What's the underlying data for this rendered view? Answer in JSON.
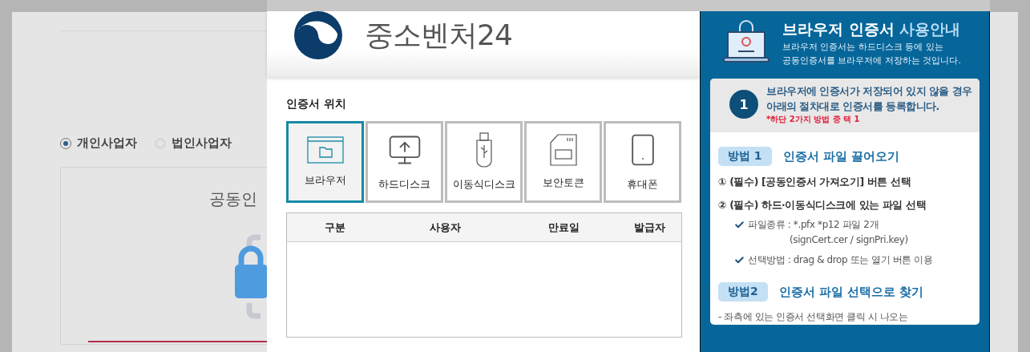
{
  "background_page": {
    "radio_options": [
      {
        "label": "개인사업자",
        "selected": true
      },
      {
        "label": "법인사업자",
        "selected": false
      }
    ],
    "card_title": "공동인"
  },
  "modal": {
    "logo_text": "중소벤처24",
    "location_label": "인증서 위치",
    "locations": [
      {
        "label": "브라우저",
        "kind": "browser",
        "selected": true
      },
      {
        "label": "하드디스크",
        "kind": "harddisk",
        "selected": false
      },
      {
        "label": "이동식디스크",
        "kind": "usb",
        "selected": false
      },
      {
        "label": "보안토큰",
        "kind": "token",
        "selected": false
      },
      {
        "label": "휴대폰",
        "kind": "phone",
        "selected": false
      }
    ],
    "table": {
      "columns": [
        "구분",
        "사용자",
        "만료일",
        "발급자"
      ]
    }
  },
  "guide": {
    "title": "브라우저 인증서",
    "title_accent": "사용안내",
    "subtitle": [
      "브라우저 인증서는 하드디스크 등에 있는",
      "공동인증서를 브라우저에 저장하는 것입니다."
    ],
    "step": {
      "number": "1",
      "lines": [
        "브라우저에 인증서가 저장되어 있지 않을 경우",
        "아래의 절차대로 인증서를 등록합니다."
      ],
      "note": "*하단 2가지 방법 중 택 1"
    },
    "methods": [
      {
        "badge": "방법 1",
        "title": "인증서 파일 끌어오기",
        "items": [
          {
            "kind": "numbered",
            "lines": [
              "① (필수) [공동인증서 가져오기] 버튼 선택"
            ]
          },
          {
            "kind": "numbered",
            "lines": [
              "② (필수) 하드·이동식디스크에 있는 파일 선택"
            ]
          },
          {
            "kind": "check",
            "lines": [
              "파일종류 : *.pfx *p12 파일 2개",
              "(signCert.cer / signPri.key)"
            ]
          },
          {
            "kind": "check",
            "lines": [
              "선택방법 : drag & drop 또는 열기 버튼 이용"
            ]
          }
        ]
      },
      {
        "badge": "방법2",
        "title": "인증서 파일 선택으로 찾기",
        "items": [
          {
            "kind": "dash",
            "lines": [
              "- 좌측에 있는 인증서 선택화면 클릭 시 나오는"
            ]
          }
        ]
      }
    ]
  }
}
